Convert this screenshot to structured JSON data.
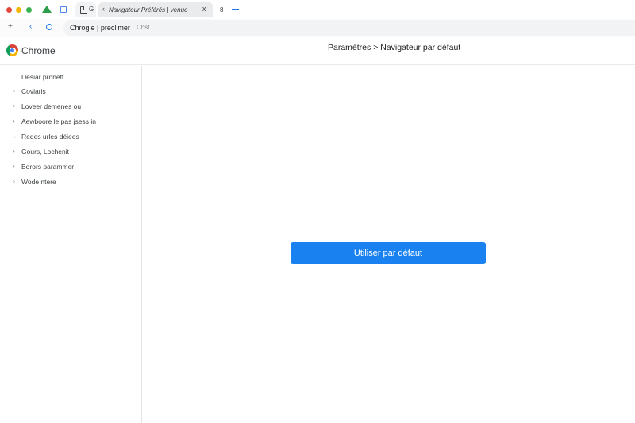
{
  "tabs": {
    "tab1_letter": "G",
    "tab2_back": "‹",
    "tab2_title": "Navigateur Préférés | venue",
    "tab2_close": "x",
    "tab3_label": "8"
  },
  "toolbar": {
    "menu_icon": "+",
    "back_icon": "‹",
    "omnibox_text": "Chrogle | preclimer",
    "omnibox_suggestion": "Chst"
  },
  "header": {
    "brand": "Chrome",
    "breadcrumb": "Paramètres > Navigateur par défaut"
  },
  "sidebar": {
    "items": [
      {
        "label": "Desiar proneff",
        "icon": ""
      },
      {
        "label": "Coviaris",
        "icon": "◦"
      },
      {
        "label": "Loveer demenes ou",
        "icon": "◦"
      },
      {
        "label": "Aewboore le pas jsess in",
        "icon": "›"
      },
      {
        "label": "Redes urles déiees",
        "icon": "→"
      },
      {
        "label": "Gours, Lochenit",
        "icon": "›"
      },
      {
        "label": "Borors parammer",
        "icon": "›"
      },
      {
        "label": "Wode ntere",
        "icon": "◦"
      }
    ]
  },
  "main": {
    "set_default_label": "Utiliser par défaut"
  },
  "colors": {
    "accent": "#1a82f0",
    "sidebar_border": "#e3e3e3"
  }
}
